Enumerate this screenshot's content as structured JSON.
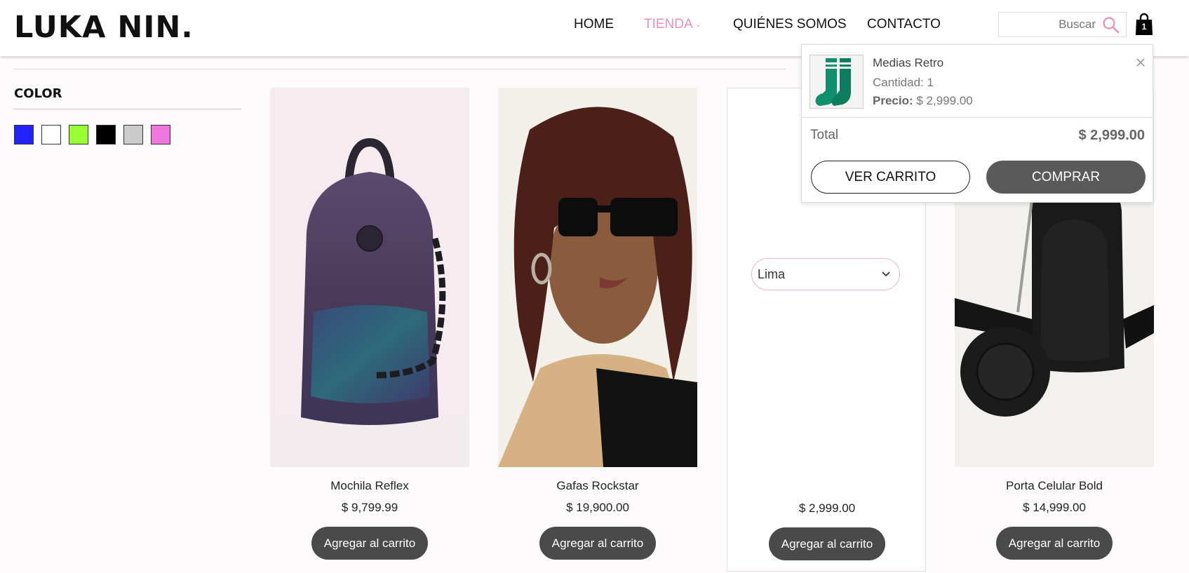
{
  "brand": {
    "logo_text": "LUKA NIN."
  },
  "nav": {
    "items": [
      {
        "label": "HOME"
      },
      {
        "label": "TIENDA"
      },
      {
        "label": "QUIÉNES SOMOS"
      },
      {
        "label": "CONTACTO"
      }
    ],
    "active": "TIENDA"
  },
  "search": {
    "placeholder": "Buscar",
    "icon": "search-icon"
  },
  "cart_badge": {
    "count": "1",
    "icon": "shopping-bag-icon"
  },
  "filters": {
    "title": "COLOR",
    "colors": [
      "#2222ff",
      "#ffffff",
      "#99ff33",
      "#000000",
      "#cccccc",
      "#ee77dd"
    ]
  },
  "products": [
    {
      "name": "Mochila Reflex",
      "price": "$ 9,799.99",
      "button": "Agregar al carrito"
    },
    {
      "name": "Gafas Rockstar",
      "price": "$ 19,900.00",
      "button": "Agregar al carrito"
    },
    {
      "name": "",
      "price": "$ 2,999.00",
      "button": "Agregar al carrito",
      "variant": "Lima"
    },
    {
      "name": "Porta Celular Bold",
      "price": "$ 14,999.00",
      "button": "Agregar al carrito"
    }
  ],
  "cart": {
    "item_name": "Medias Retro",
    "quantity": "Cantidad: 1",
    "price_label": "Precio:",
    "price_value": "$ 2,999.00",
    "total_label": "Total",
    "total_value": "$ 2,999.00",
    "view_button": "VER CARRITO",
    "buy_button": "COMPRAR"
  },
  "colors": {
    "accent_pink": "#e98fbf",
    "button_dark": "#4a4a4a"
  }
}
